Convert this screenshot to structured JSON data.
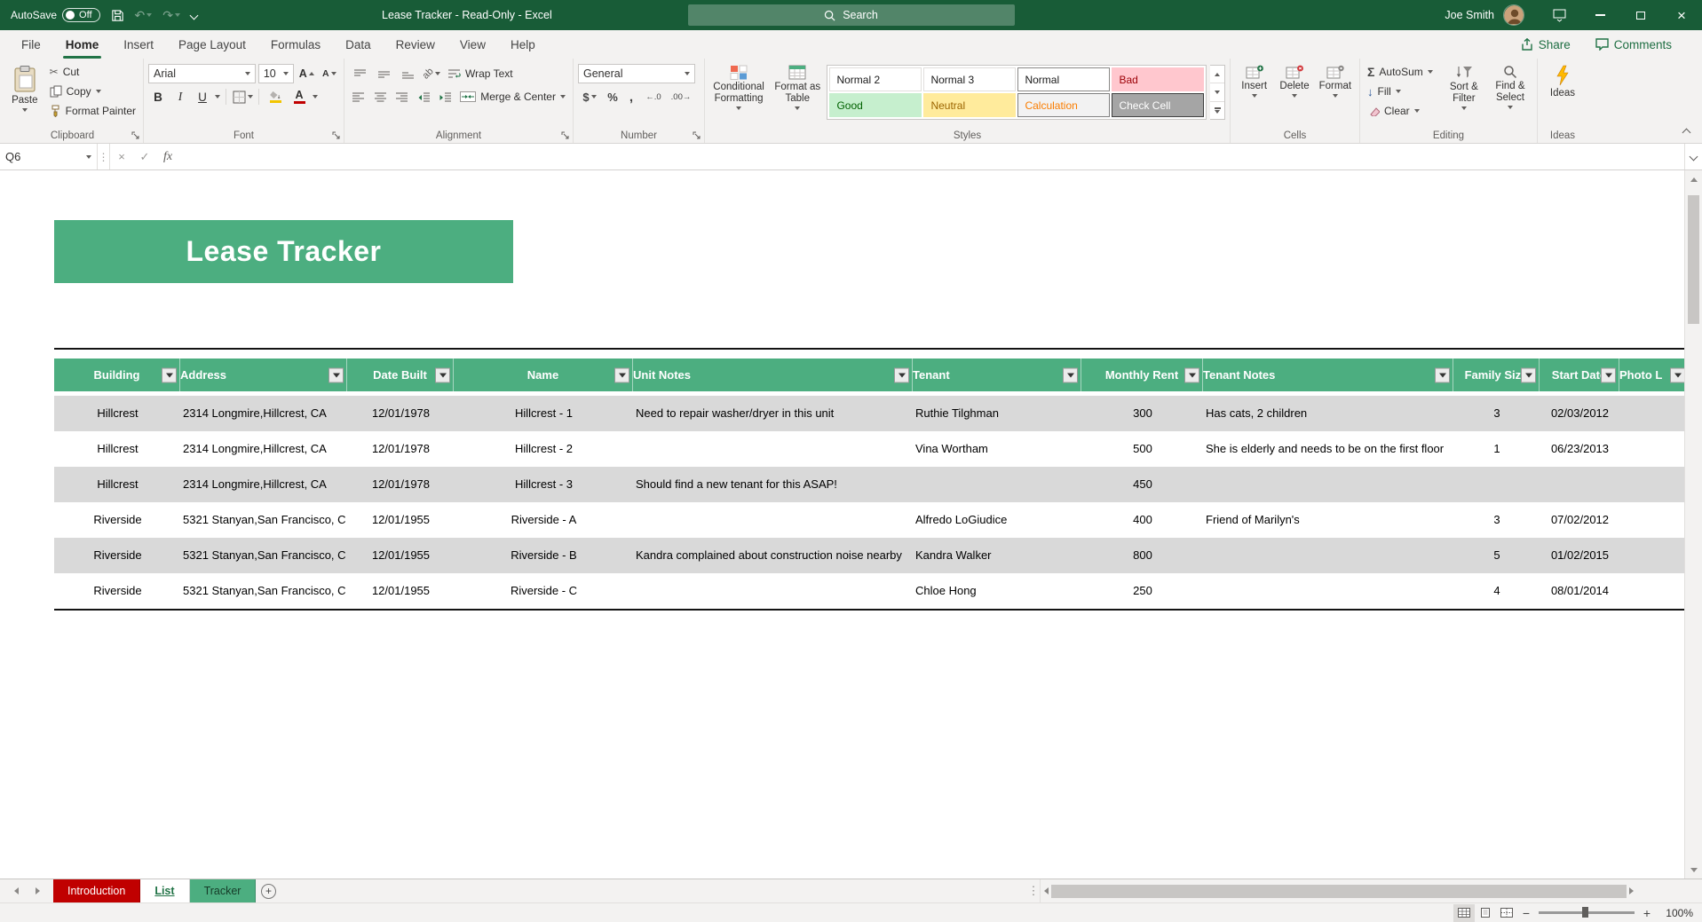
{
  "titlebar": {
    "autosave_label": "AutoSave",
    "autosave_state": "Off",
    "window_title": "Lease Tracker - Read-Only - Excel",
    "search_placeholder": "Search",
    "user_name": "Joe Smith"
  },
  "ribbon": {
    "tabs": [
      {
        "label": "File",
        "active": false
      },
      {
        "label": "Home",
        "active": true
      },
      {
        "label": "Insert",
        "active": false
      },
      {
        "label": "Page Layout",
        "active": false
      },
      {
        "label": "Formulas",
        "active": false
      },
      {
        "label": "Data",
        "active": false
      },
      {
        "label": "Review",
        "active": false
      },
      {
        "label": "View",
        "active": false
      },
      {
        "label": "Help",
        "active": false
      }
    ],
    "share_label": "Share",
    "comments_label": "Comments",
    "clipboard": {
      "label": "Clipboard",
      "paste": "Paste",
      "cut": "Cut",
      "copy": "Copy",
      "format_painter": "Format Painter"
    },
    "font": {
      "label": "Font",
      "family": "Arial",
      "size": "10",
      "bold": "B",
      "italic": "I",
      "underline": "U"
    },
    "alignment": {
      "label": "Alignment",
      "wrap_text": "Wrap Text",
      "merge_center": "Merge & Center"
    },
    "number": {
      "label": "Number",
      "format": "General",
      "currency": "$",
      "percent": "%",
      "comma": ",",
      "increase_decimal": "←.0",
      "decrease_decimal": ".00→"
    },
    "styles": {
      "label": "Styles",
      "conditional_formatting": "Conditional Formatting",
      "format_as_table": "Format as Table",
      "gallery": [
        {
          "name": "Normal 2",
          "bg": "#ffffff",
          "fg": "#1a1a1a",
          "border": "#e1dfdd",
          "selected": false
        },
        {
          "name": "Normal 3",
          "bg": "#ffffff",
          "fg": "#1a1a1a",
          "border": "#e1dfdd",
          "selected": false
        },
        {
          "name": "Normal",
          "bg": "#ffffff",
          "fg": "#1a1a1a",
          "border": "#8a8886",
          "selected": true
        },
        {
          "name": "Bad",
          "bg": "#ffc7ce",
          "fg": "#9c0006",
          "border": "#ffc7ce",
          "selected": false
        },
        {
          "name": "Good",
          "bg": "#c6efce",
          "fg": "#006100",
          "border": "#c6efce",
          "selected": false
        },
        {
          "name": "Neutral",
          "bg": "#ffeb9c",
          "fg": "#9c6500",
          "border": "#ffeb9c",
          "selected": false
        },
        {
          "name": "Calculation",
          "bg": "#f2f2f2",
          "fg": "#fa7d00",
          "border": "#7f7f7f",
          "selected": false
        },
        {
          "name": "Check Cell",
          "bg": "#a5a5a5",
          "fg": "#ffffff",
          "border": "#3f3f3f",
          "selected": false
        }
      ]
    },
    "cells": {
      "label": "Cells",
      "insert": "Insert",
      "delete": "Delete",
      "format": "Format"
    },
    "editing": {
      "label": "Editing",
      "autosum": "AutoSum",
      "fill": "Fill",
      "clear": "Clear",
      "sort_filter": "Sort & Filter",
      "find_select": "Find & Select"
    },
    "ideas": {
      "label": "Ideas",
      "button": "Ideas"
    }
  },
  "formula_bar": {
    "name_box": "Q6",
    "formula_value": ""
  },
  "sheet": {
    "banner_title": "Lease Tracker",
    "table": {
      "columns": [
        "Building",
        "Address",
        "Date Built",
        "Name",
        "Unit Notes",
        "Tenant",
        "Monthly Rent",
        "Tenant Notes",
        "Family Size",
        "Start Date",
        "Photo L"
      ],
      "rows": [
        [
          "Hillcrest",
          "2314 Longmire,Hillcrest, CA",
          "12/01/1978",
          "Hillcrest - 1",
          "Need to repair washer/dryer in this unit",
          "Ruthie Tilghman",
          "300",
          "Has cats, 2 children",
          "3",
          "02/03/2012",
          ""
        ],
        [
          "Hillcrest",
          "2314 Longmire,Hillcrest, CA",
          "12/01/1978",
          "Hillcrest - 2",
          "",
          "Vina Wortham",
          "500",
          "She is elderly and needs to be on the first floor",
          "1",
          "06/23/2013",
          ""
        ],
        [
          "Hillcrest",
          "2314 Longmire,Hillcrest, CA",
          "12/01/1978",
          "Hillcrest - 3",
          "Should find a new tenant for this ASAP!",
          "",
          "450",
          "",
          "",
          "",
          ""
        ],
        [
          "Riverside",
          "5321 Stanyan,San Francisco, C",
          "12/01/1955",
          "Riverside - A",
          "",
          "Alfredo LoGiudice",
          "400",
          "Friend of Marilyn's",
          "3",
          "07/02/2012",
          ""
        ],
        [
          "Riverside",
          "5321 Stanyan,San Francisco, C",
          "12/01/1955",
          "Riverside - B",
          "Kandra complained about construction noise nearby",
          "Kandra Walker",
          "800",
          "",
          "5",
          "01/02/2015",
          ""
        ],
        [
          "Riverside",
          "5321 Stanyan,San Francisco, C",
          "12/01/1955",
          "Riverside - C",
          "",
          "Chloe Hong",
          "250",
          "",
          "4",
          "08/01/2014",
          ""
        ]
      ]
    }
  },
  "sheet_tabs": [
    {
      "label": "Introduction",
      "bg": "#c00000",
      "fg": "#ffffff",
      "active": false
    },
    {
      "label": "List",
      "bg": "#ffffff",
      "fg": "#217346",
      "active": true
    },
    {
      "label": "Tracker",
      "bg": "#4cae80",
      "fg": "#163b28",
      "active": false
    }
  ],
  "status_bar": {
    "zoom_level": "100%"
  },
  "icons": {
    "scissors": "✂",
    "undo": "↶",
    "redo": "↷",
    "sigma": "Σ",
    "fill_down": "↓",
    "cancel": "×",
    "enter": "✓",
    "fx": "fx",
    "dots": "⋮",
    "plus": "+",
    "minus": "−",
    "close": "×",
    "letter_a": "A",
    "orientation": "ab"
  },
  "colors": {
    "titlebar_green": "#185c37",
    "accent_green": "#217346",
    "banner_green": "#4cae80",
    "row_band_gray": "#d9d9d9",
    "tab_introduction_red": "#c00000",
    "tab_tracker_green": "#4cae80"
  }
}
